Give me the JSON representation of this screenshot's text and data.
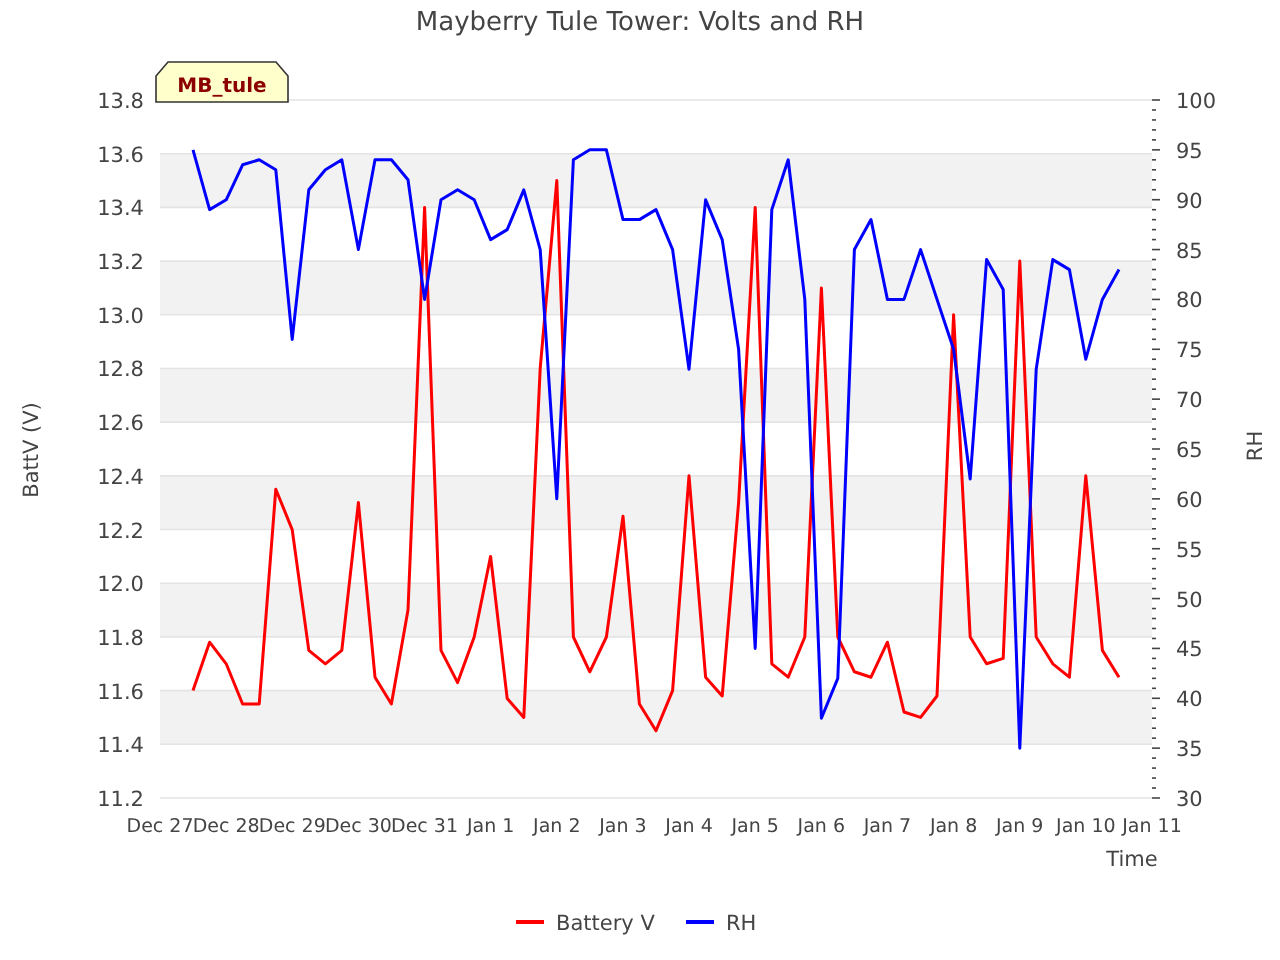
{
  "chart": {
    "badge": "MB_tule",
    "chart_data": {
      "type": "line",
      "title": "Mayberry Tule Tower: Volts and RH",
      "xlabel": "Time",
      "ylabel": "BattV (V)",
      "y2label": "RH",
      "grid": true,
      "legend": "bottom",
      "ylim": [
        11.2,
        13.8
      ],
      "y2lim": [
        30,
        100
      ],
      "categories": [
        "Dec 27",
        null,
        null,
        null,
        "Dec 28",
        null,
        null,
        null,
        "Dec 29",
        null,
        null,
        null,
        "Dec 30",
        null,
        null,
        null,
        "Dec 31",
        null,
        null,
        null,
        "Jan 1",
        null,
        null,
        null,
        "Jan 2",
        null,
        null,
        null,
        "Jan 3",
        null,
        null,
        null,
        "Jan 4",
        null,
        null,
        null,
        "Jan 5",
        null,
        null,
        null,
        "Jan 6",
        null,
        null,
        null,
        "Jan 7",
        null,
        null,
        null,
        "Jan 8",
        null,
        null,
        null,
        "Jan 9",
        null,
        null,
        null,
        "Jan 10",
        null,
        null,
        null,
        "Jan 11"
      ],
      "yticks": [
        {
          "value": 11.2,
          "label": "11.2"
        },
        {
          "value": 11.4,
          "label": "11.4"
        },
        {
          "value": 11.6,
          "label": "11.6"
        },
        {
          "value": 11.8,
          "label": "11.8"
        },
        {
          "value": 12.0,
          "label": "12.0"
        },
        {
          "value": 12.2,
          "label": "12.2"
        },
        {
          "value": 12.4,
          "label": "12.4"
        },
        {
          "value": 12.6,
          "label": "12.6"
        },
        {
          "value": 12.8,
          "label": "12.8"
        },
        {
          "value": 13.0,
          "label": "13.0"
        },
        {
          "value": 13.2,
          "label": "13.2"
        },
        {
          "value": 13.4,
          "label": "13.4"
        },
        {
          "value": 13.6,
          "label": "13.6"
        },
        {
          "value": 13.8,
          "label": "13.8"
        }
      ],
      "y2ticks": [
        30,
        35,
        40,
        45,
        50,
        55,
        60,
        65,
        70,
        75,
        80,
        85,
        90,
        95,
        100
      ],
      "series": [
        {
          "name": "Battery V",
          "color": "#ff0000",
          "values": [
            null,
            null,
            11.6,
            11.78,
            11.7,
            11.55,
            11.55,
            12.35,
            12.2,
            11.75,
            11.7,
            11.75,
            12.3,
            11.65,
            11.55,
            11.9,
            13.4,
            11.75,
            11.63,
            11.8,
            12.1,
            11.57,
            11.5,
            12.8,
            13.5,
            11.8,
            11.67,
            11.8,
            12.25,
            11.55,
            11.45,
            11.6,
            12.4,
            11.65,
            11.58,
            12.3,
            13.4,
            11.7,
            11.65,
            11.8,
            13.1,
            11.8,
            11.67,
            11.65,
            11.78,
            11.52,
            11.5,
            11.58,
            13.0,
            11.8,
            11.7,
            11.72,
            13.2,
            11.8,
            11.7,
            11.65,
            12.4,
            11.75,
            11.65,
            null,
            null
          ]
        },
        {
          "name": "RH",
          "color": "#0000ff",
          "axis": "y2",
          "values": [
            null,
            null,
            95,
            89,
            90,
            93.5,
            94,
            93,
            76,
            91,
            93,
            94,
            85,
            94,
            94,
            92,
            80,
            90,
            91,
            90,
            86,
            87,
            91,
            85,
            60,
            94,
            95,
            95,
            88,
            88,
            89,
            85,
            73,
            90,
            86,
            75,
            45,
            89,
            94,
            80,
            38,
            42,
            85,
            88,
            80,
            80,
            85,
            80,
            75,
            62,
            84,
            81,
            35,
            73,
            84,
            83,
            74,
            80,
            83,
            null,
            null
          ]
        }
      ]
    }
  }
}
